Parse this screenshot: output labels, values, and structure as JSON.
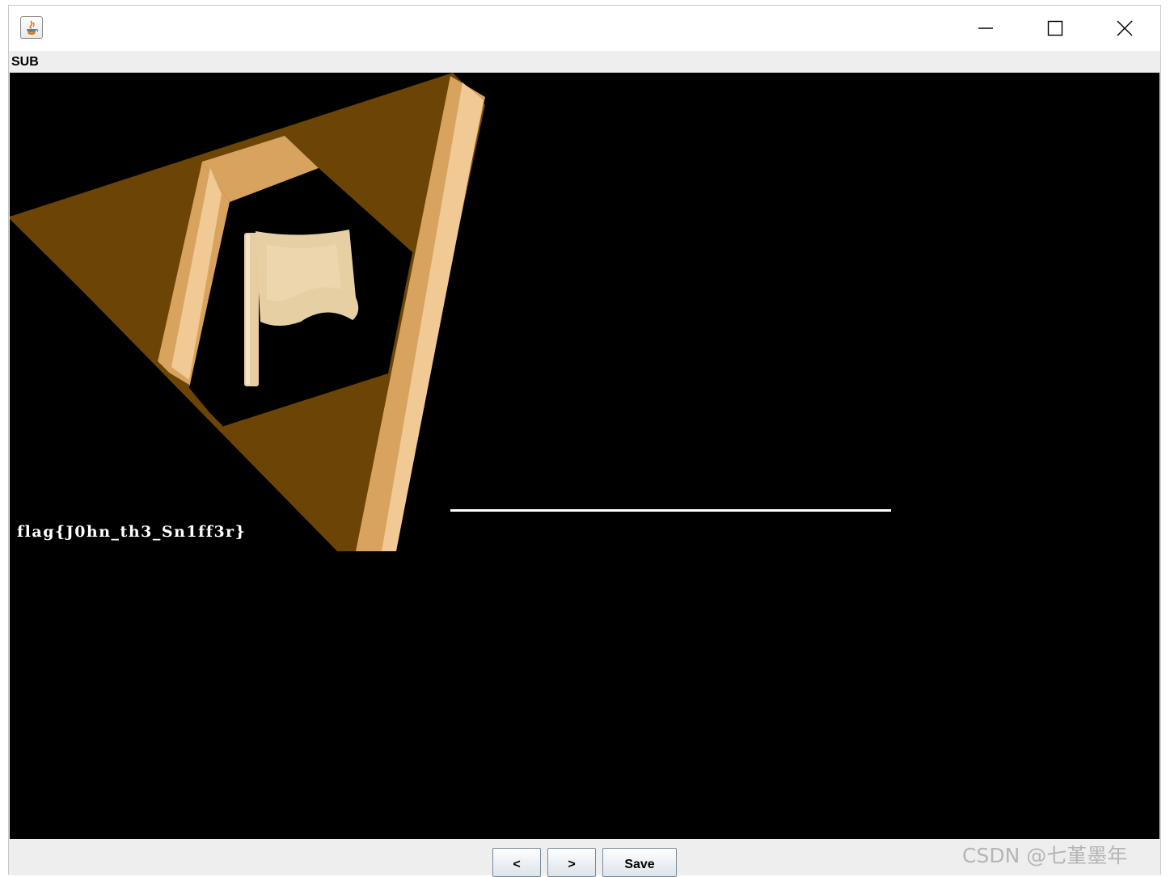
{
  "window": {
    "app_icon": "java-coffee-cup-icon",
    "controls": {
      "minimize": "minimize-icon",
      "maximize": "maximize-icon",
      "close": "close-icon"
    }
  },
  "menubar": {
    "items": [
      {
        "label": "SUB"
      }
    ]
  },
  "canvas": {
    "background": "#000000",
    "image": {
      "description_icon": "flag-emblem-icon",
      "colors": {
        "dark_brown": "#6b4406",
        "tan": "#d7a35e",
        "light_tan": "#f0c994",
        "flag_cream": "#e6cfa3"
      }
    },
    "flag_text": "flag{J0hn_th3_Sn1ff3r}"
  },
  "buttons": {
    "prev_label": "<",
    "next_label": ">",
    "save_label": "Save"
  },
  "watermark": "CSDN @七堇墨年"
}
